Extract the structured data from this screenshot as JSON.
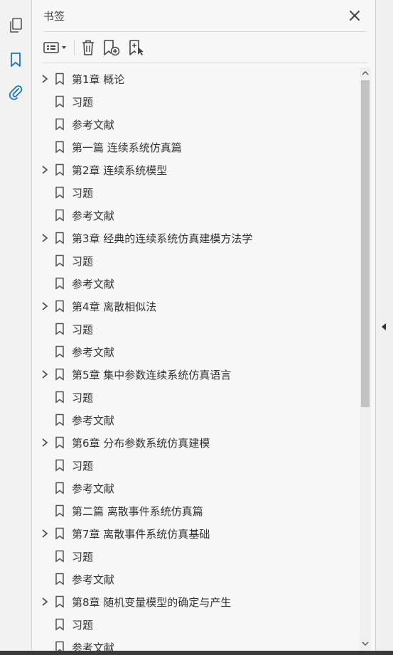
{
  "panel": {
    "title": "书签"
  },
  "icons": {
    "rail": [
      "pages-icon",
      "bookmark-icon",
      "attachment-icon"
    ],
    "toolbar": [
      "options-menu-icon",
      "delete-icon",
      "new-bookmark-icon",
      "new-bookmark-from-structure-icon"
    ],
    "accent": "#1a73c8"
  },
  "bookmarks": [
    {
      "label": "第1章 概论",
      "expandable": true
    },
    {
      "label": "习题",
      "expandable": false
    },
    {
      "label": "参考文献",
      "expandable": false
    },
    {
      "label": "第一篇 连续系统仿真篇",
      "expandable": false
    },
    {
      "label": "第2章 连续系统模型",
      "expandable": true
    },
    {
      "label": "习题",
      "expandable": false
    },
    {
      "label": "参考文献",
      "expandable": false
    },
    {
      "label": "第3章 经典的连续系统仿真建模方法学",
      "expandable": true
    },
    {
      "label": "习题",
      "expandable": false
    },
    {
      "label": "参考文献",
      "expandable": false
    },
    {
      "label": "第4章 离散相似法",
      "expandable": true
    },
    {
      "label": "习题",
      "expandable": false
    },
    {
      "label": "参考文献",
      "expandable": false
    },
    {
      "label": "第5章 集中参数连续系统仿真语言",
      "expandable": true
    },
    {
      "label": "习题",
      "expandable": false
    },
    {
      "label": "参考文献",
      "expandable": false
    },
    {
      "label": "第6章 分布参数系统仿真建模",
      "expandable": true
    },
    {
      "label": "习题",
      "expandable": false
    },
    {
      "label": "参考文献",
      "expandable": false
    },
    {
      "label": "第二篇 离散事件系统仿真篇",
      "expandable": false
    },
    {
      "label": "第7章 离散事件系统仿真基础",
      "expandable": true
    },
    {
      "label": "习题",
      "expandable": false
    },
    {
      "label": "参考文献",
      "expandable": false
    },
    {
      "label": "第8章 随机变量模型的确定与产生",
      "expandable": true
    },
    {
      "label": "习题",
      "expandable": false
    },
    {
      "label": "参考文献",
      "expandable": false
    }
  ]
}
